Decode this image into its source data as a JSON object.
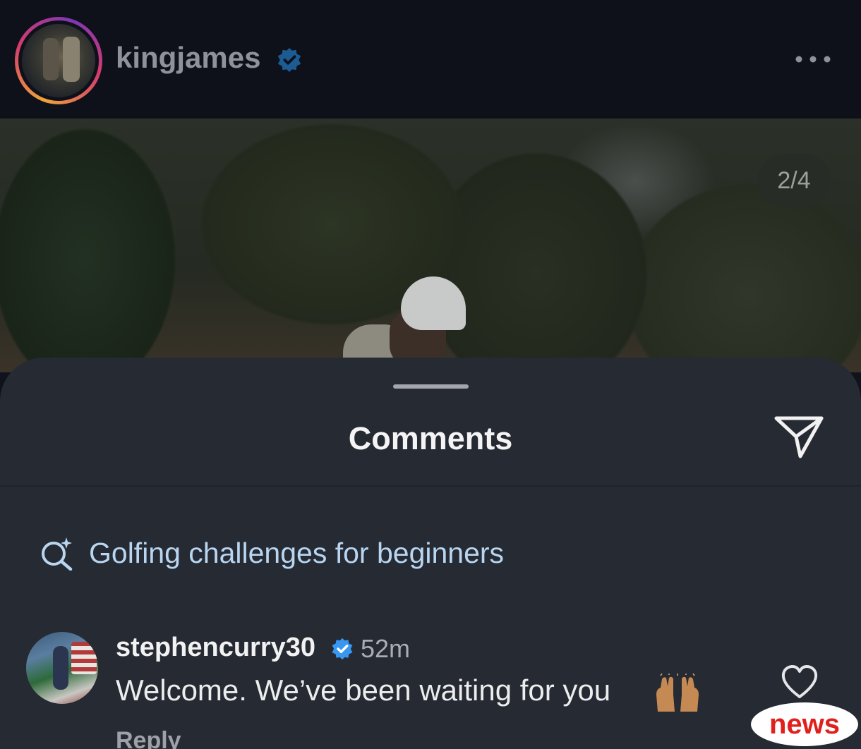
{
  "post": {
    "username": "kingjames",
    "verified": true,
    "more_icon": "more-horizontal-icon",
    "image_counter": "2/4"
  },
  "comments_sheet": {
    "title": "Comments",
    "share_icon": "send-icon",
    "search_suggestion": {
      "icon": "search-sparkle-icon",
      "text": "Golfing challenges for beginners"
    },
    "comments": [
      {
        "username": "stephencurry30",
        "verified": true,
        "time": "52m",
        "text": "Welcome. We’ve been waiting for you",
        "emoji": "raising-hands-icon",
        "like_icon": "heart-icon",
        "reply_label": "Reply"
      }
    ]
  },
  "watermark": {
    "label": "news"
  },
  "colors": {
    "sheet_bg": "#262a33",
    "header_bg": "#0e111a",
    "verified_blue": "#3897f0",
    "suggestion_text": "#b8d6f1",
    "watermark_red": "#e0201c"
  }
}
